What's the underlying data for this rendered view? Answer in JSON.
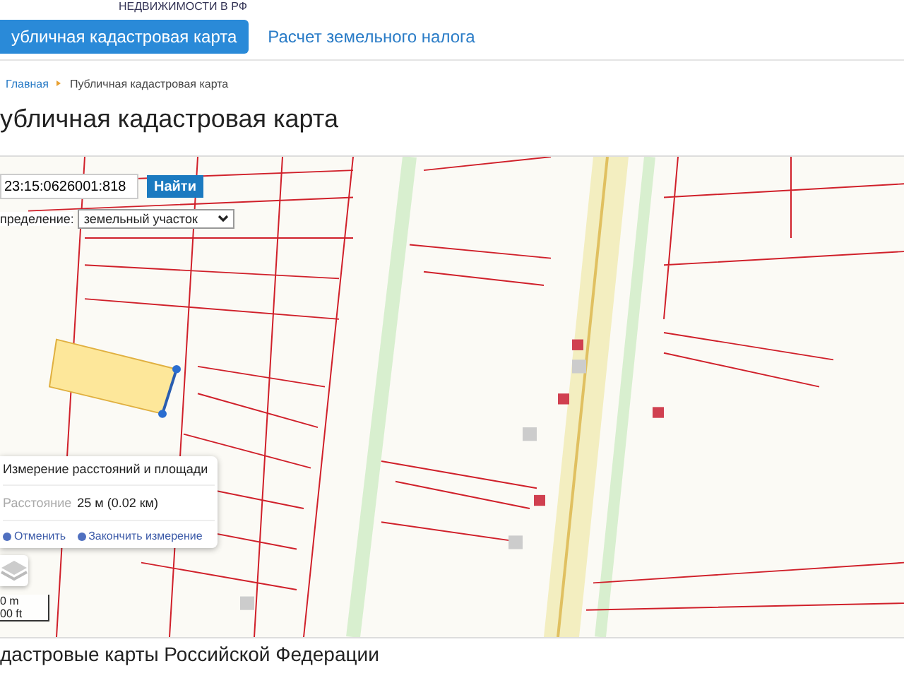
{
  "header": {
    "logo_text": "НЕДВИЖИМОСТИ В РФ"
  },
  "tabs": [
    {
      "label": "убличная кадастровая карта",
      "selected": true
    },
    {
      "label": "Расчет земельного налога",
      "selected": false
    }
  ],
  "breadcrumb": [
    "Главная",
    "Публичная кадастровая карта"
  ],
  "title": "убличная кадастровая карта",
  "map": {
    "search": {
      "value": "23:15:0626001:818",
      "button": "Найти"
    },
    "definition": {
      "label": "пределение:",
      "value": "земельный участок"
    },
    "measure": {
      "title": "Измерение расстояний и площади",
      "label": "Расстояние",
      "value": "25 м (0.02 км)",
      "actions": [
        "Отменить",
        "Закончить измерение"
      ]
    },
    "scale": [
      "0 m",
      "00 ft"
    ]
  },
  "section_title": "дастровые карты Российской Федерации"
}
